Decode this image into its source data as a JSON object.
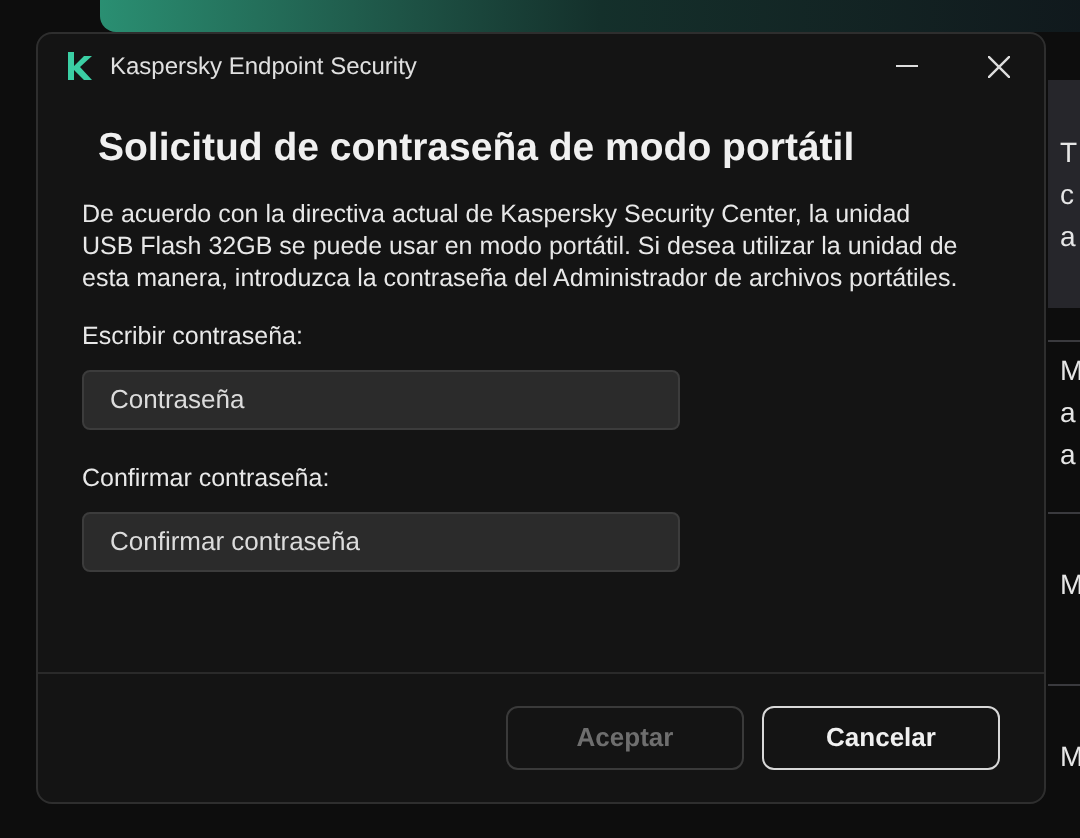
{
  "background_app": {
    "panels": [
      {
        "kind": "card",
        "lines": [
          "T",
          "c",
          "a"
        ]
      },
      {
        "kind": "row",
        "lines": [
          "M",
          "a",
          "a"
        ]
      },
      {
        "kind": "row",
        "lines": [
          "M"
        ]
      },
      {
        "kind": "row",
        "lines": [
          "M"
        ]
      }
    ]
  },
  "window": {
    "title": "Kaspersky Endpoint Security"
  },
  "dialog": {
    "heading": "Solicitud de contraseña de modo portátil",
    "description": "De acuerdo con la directiva actual de Kaspersky Security Center, la unidad USB Flash 32GB se puede usar en modo portátil. Si desea utilizar la unidad de esta manera, introduzca la contraseña del Administrador de archivos portátiles.",
    "fields": [
      {
        "label": "Escribir contraseña:",
        "placeholder": "Contraseña"
      },
      {
        "label": "Confirmar contraseña:",
        "placeholder": "Confirmar contraseña"
      }
    ],
    "buttons": [
      {
        "label": "Aceptar",
        "disabled": true
      },
      {
        "label": "Cancelar",
        "disabled": false
      }
    ]
  }
}
